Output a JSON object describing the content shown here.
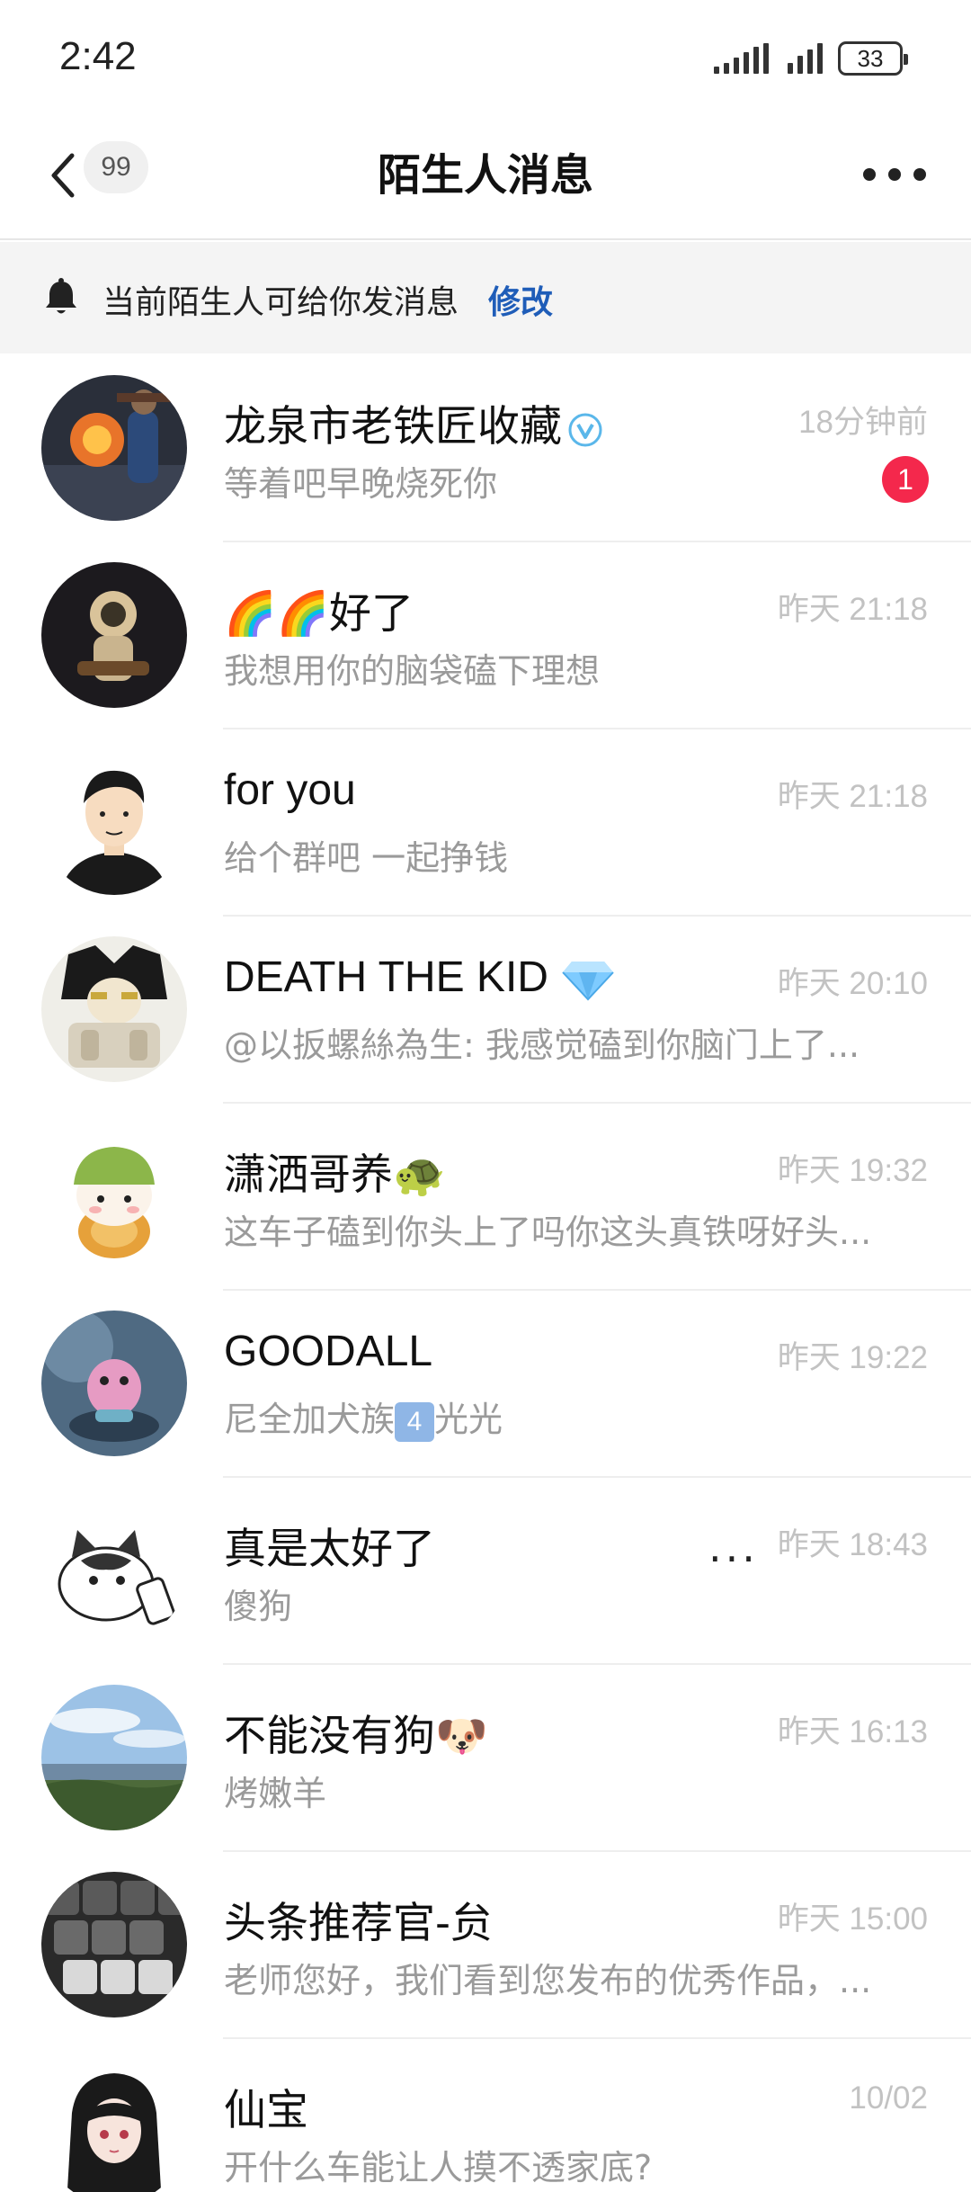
{
  "status_bar": {
    "time": "2:42",
    "battery": "33"
  },
  "header": {
    "back_count": "99",
    "title": "陌生人消息"
  },
  "notice": {
    "text": "当前陌生人可给你发消息",
    "link": "修改"
  },
  "conversations": [
    {
      "name": "龙泉市老铁匠收藏",
      "preview": "等着吧早晚烧死你",
      "time": "18分钟前",
      "unread": "1",
      "name_icon": "verified-icon"
    },
    {
      "name": "🌈🌈好了",
      "preview": "我想用你的脑袋磕下理想",
      "time": "昨天 21:18"
    },
    {
      "name": "for you",
      "preview": "给个群吧 一起挣钱",
      "time": "昨天 21:18"
    },
    {
      "name": "DEATH THE KID",
      "preview": "@以扳螺絲為生: 我感觉磕到你脑门上了...",
      "time": "昨天 20:10",
      "name_icon": "diamond-icon"
    },
    {
      "name": "潇洒哥养🐢",
      "preview": "这车子磕到你头上了吗你这头真铁呀好头...",
      "time": "昨天 19:32"
    },
    {
      "name": "GOODALL",
      "preview_before": "尼全加犬族",
      "preview_badge": "4",
      "preview_after": "光光",
      "time": "昨天 19:22"
    },
    {
      "name": "真是太好了",
      "name_suffix": "...",
      "preview": "傻狗",
      "time": "昨天 18:43"
    },
    {
      "name": "不能没有狗🐶",
      "preview": "烤嫩羊",
      "time": "昨天 16:13"
    },
    {
      "name": "头条推荐官-贠",
      "preview": "老师您好，我们看到您发布的优秀作品，...",
      "time": "昨天 15:00"
    },
    {
      "name": "仙宝",
      "preview": "开什么车能让人摸不透家底?",
      "time": "10/02"
    }
  ]
}
